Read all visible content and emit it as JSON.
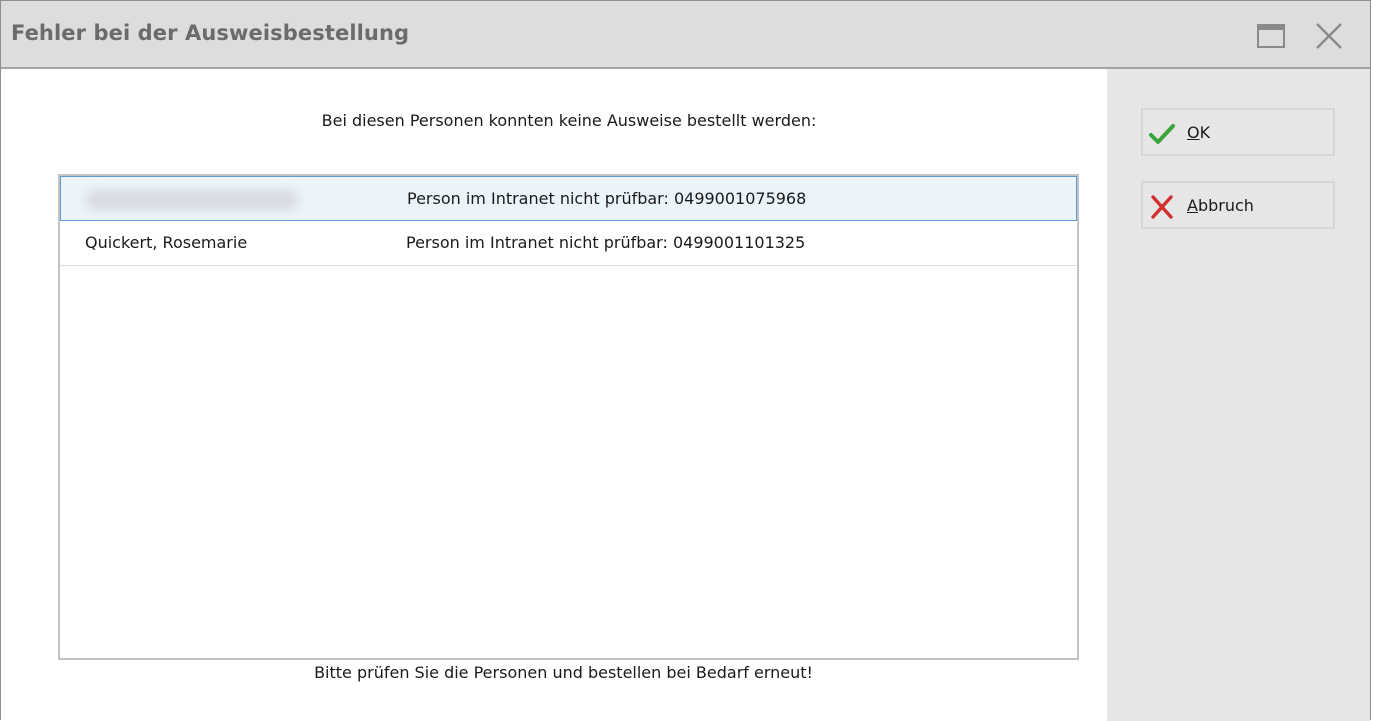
{
  "window": {
    "title": "Fehler bei der Ausweisbestellung"
  },
  "message": {
    "top": "Bei diesen Personen konnten keine Ausweise bestellt werden:",
    "bottom": "Bitte prüfen Sie die Personen und bestellen bei Bedarf erneut!"
  },
  "list": {
    "rows": [
      {
        "name": "",
        "reason": "Person im Intranet nicht prüfbar: 0499001075968",
        "selected": true,
        "name_redacted": true
      },
      {
        "name": "Quickert, Rosemarie",
        "reason": "Person im Intranet nicht prüfbar: 0499001101325",
        "selected": false
      }
    ]
  },
  "buttons": {
    "ok": {
      "mnemonic": "O",
      "rest": "K",
      "icon": "check-icon"
    },
    "cancel": {
      "mnemonic": "A",
      "rest": "bbruch",
      "icon": "x-icon"
    }
  },
  "colors": {
    "check": "#3aa53a",
    "cross": "#d32f2f",
    "selection": "#5b9bd5"
  }
}
